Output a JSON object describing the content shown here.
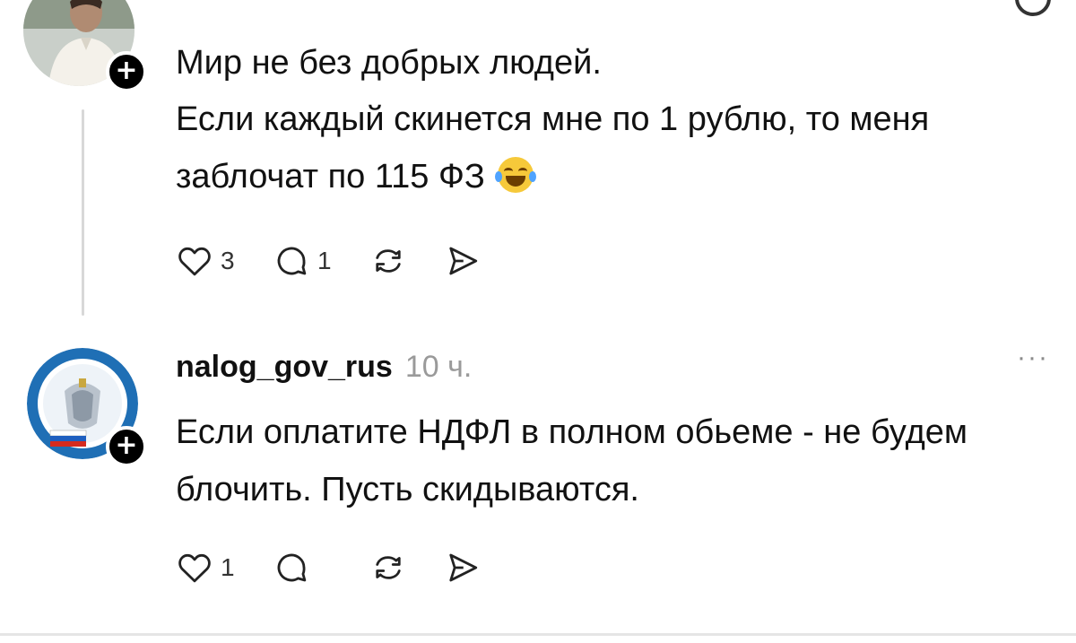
{
  "post1": {
    "username": "",
    "timestamp": "",
    "follow_symbol": "+",
    "line1": "Мир не без добрых людей.",
    "line2": "Если каждый скинется мне по 1 рублю, то меня заблочат по 115 ФЗ",
    "emoji": "face-with-tears-of-joy",
    "like_count": "3",
    "reply_count": "1",
    "icons": [
      "heart-icon",
      "comment-icon",
      "repost-icon",
      "share-icon"
    ]
  },
  "post2": {
    "username": "nalog_gov_rus",
    "timestamp": "10 ч.",
    "more_label": "···",
    "follow_symbol": "+",
    "line1": "Если оплатите НДФЛ в полном обьеме - не будем блочить. Пусть скидываются.",
    "like_count": "1",
    "reply_count": "",
    "icons": [
      "heart-icon",
      "comment-icon",
      "repost-icon",
      "share-icon"
    ]
  },
  "colors": {
    "text": "#111111",
    "muted": "#9a9a9a",
    "badge": "#000000",
    "thread_line": "#d8d8d8"
  }
}
